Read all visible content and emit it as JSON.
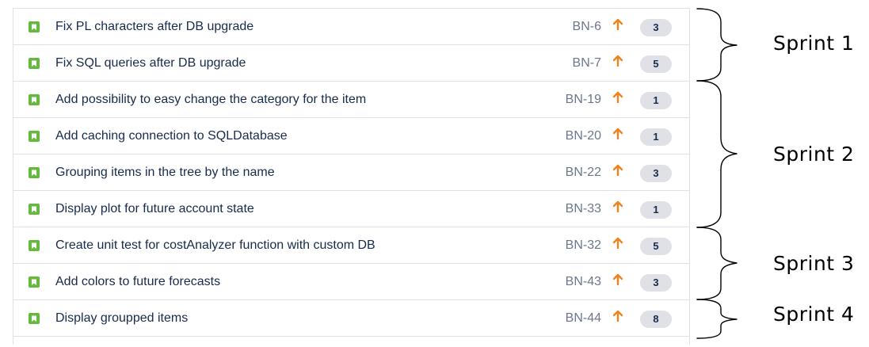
{
  "colors": {
    "story_icon": "#63ba3c",
    "priority_arrow": "#f0821e",
    "points_badge": "#dfe1e6",
    "summary_text": "#172b4d",
    "key_text": "#6b778c"
  },
  "issues": [
    {
      "summary": "Fix PL characters after DB upgrade",
      "key": "BN-6",
      "points": "3",
      "icon": "story-icon",
      "priority_icon": "priority-high-arrow-icon"
    },
    {
      "summary": "Fix SQL queries after DB upgrade",
      "key": "BN-7",
      "points": "5",
      "icon": "story-icon",
      "priority_icon": "priority-high-arrow-icon"
    },
    {
      "summary": "Add possibility to easy change the category for the item",
      "key": "BN-19",
      "points": "1",
      "icon": "story-icon",
      "priority_icon": "priority-high-arrow-icon"
    },
    {
      "summary": "Add caching connection to SQLDatabase",
      "key": "BN-20",
      "points": "1",
      "icon": "story-icon",
      "priority_icon": "priority-high-arrow-icon"
    },
    {
      "summary": "Grouping items in the tree by the name",
      "key": "BN-22",
      "points": "3",
      "icon": "story-icon",
      "priority_icon": "priority-high-arrow-icon"
    },
    {
      "summary": "Display plot for future account state",
      "key": "BN-33",
      "points": "1",
      "icon": "story-icon",
      "priority_icon": "priority-high-arrow-icon"
    },
    {
      "summary": "Create unit test for costAnalyzer function with custom DB",
      "key": "BN-32",
      "points": "5",
      "icon": "story-icon",
      "priority_icon": "priority-high-arrow-icon"
    },
    {
      "summary": "Add colors to future forecasts",
      "key": "BN-43",
      "points": "3",
      "icon": "story-icon",
      "priority_icon": "priority-high-arrow-icon"
    },
    {
      "summary": "Display groupped items",
      "key": "BN-44",
      "points": "8",
      "icon": "story-icon",
      "priority_icon": "priority-high-arrow-icon"
    }
  ],
  "sprints": [
    {
      "label": "Sprint 1",
      "issue_keys": [
        "BN-6",
        "BN-7"
      ]
    },
    {
      "label": "Sprint 2",
      "issue_keys": [
        "BN-19",
        "BN-20",
        "BN-22",
        "BN-33"
      ]
    },
    {
      "label": "Sprint 3",
      "issue_keys": [
        "BN-32",
        "BN-43"
      ]
    },
    {
      "label": "Sprint 4",
      "issue_keys": [
        "BN-44"
      ]
    }
  ]
}
